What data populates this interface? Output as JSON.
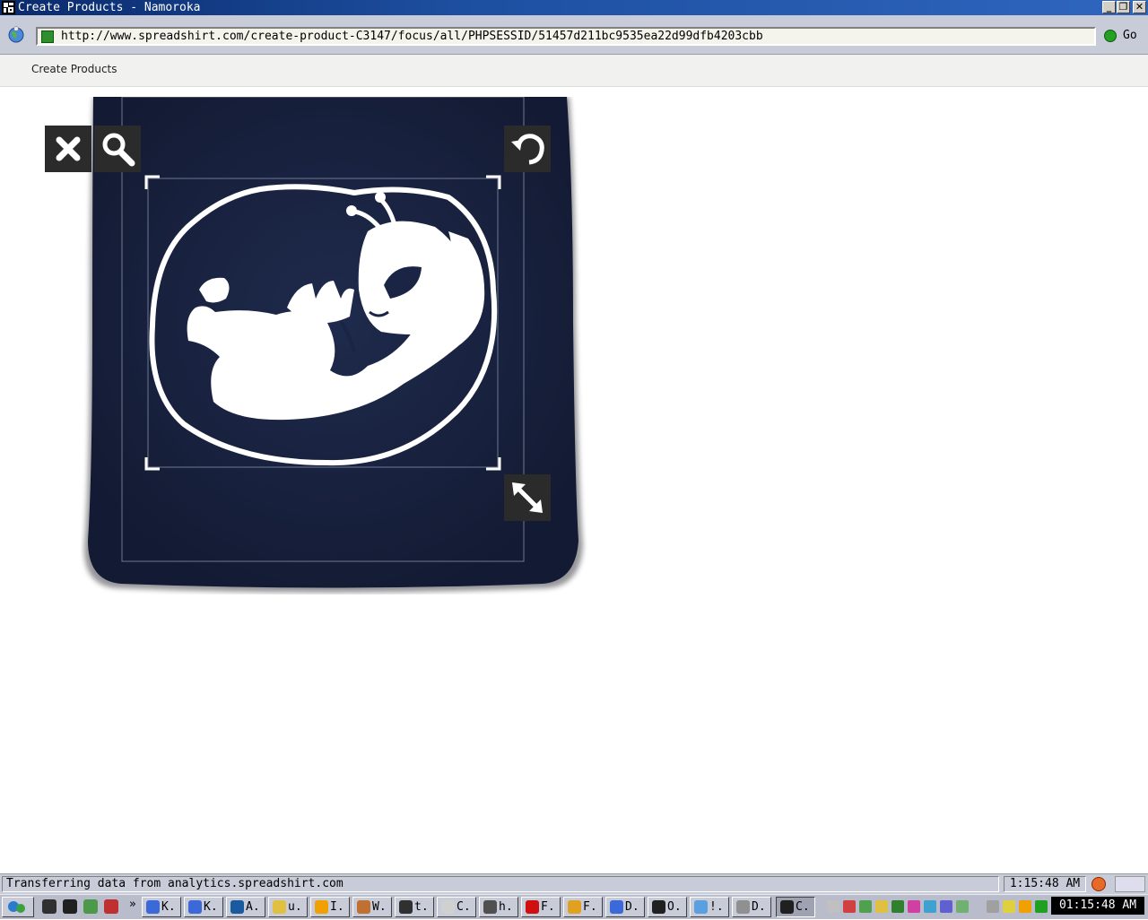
{
  "window": {
    "title": "Create Products - Namoroka",
    "buttons": {
      "minimize": "_",
      "maximize": "❐",
      "close": "✕"
    }
  },
  "navigation": {
    "url": "http://www.spreadshirt.com/create-product-C3147/focus/all/PHPSESSID/51457d211bc9535ea22d99dfb4203cbb",
    "go_label": "Go"
  },
  "page": {
    "tab_title": "Create Products"
  },
  "designer": {
    "tools": [
      {
        "name": "delete",
        "icon": "close-icon"
      },
      {
        "name": "zoom",
        "icon": "magnifier-icon"
      },
      {
        "name": "rotate",
        "icon": "rotate-icon"
      },
      {
        "name": "resize",
        "icon": "resize-arrows-icon"
      }
    ],
    "design": {
      "description_icon": "alien-fetus-graphic"
    },
    "colors": {
      "product": "#1a2444",
      "design": "#ffffff",
      "tool_bg": "#2b2b2b"
    }
  },
  "statusbar": {
    "text": "Transferring data from analytics.spreadshirt.com",
    "time": "1:15:48 AM"
  },
  "taskbar": {
    "chevron": "»",
    "tasks": [
      {
        "label": "K.",
        "color": "#3b6ad8"
      },
      {
        "label": "K.",
        "color": "#3b6ad8"
      },
      {
        "label": "A.",
        "color": "#1a5aa0"
      },
      {
        "label": "u.",
        "color": "#e0c040"
      },
      {
        "label": "I.",
        "color": "#f0a000"
      },
      {
        "label": "W.",
        "color": "#c07030"
      },
      {
        "label": "t.",
        "color": "#303030"
      },
      {
        "label": "C.",
        "color": "#d0d0d0"
      },
      {
        "label": "h.",
        "color": "#505050"
      },
      {
        "label": "F.",
        "color": "#d01010"
      },
      {
        "label": "F.",
        "color": "#e0a020"
      },
      {
        "label": "D.",
        "color": "#3b6ad8"
      },
      {
        "label": "O.",
        "color": "#202020"
      },
      {
        "label": "!.",
        "color": "#5aa0e0"
      },
      {
        "label": "D.",
        "color": "#909090"
      },
      {
        "label": "C.",
        "color": "#202020"
      }
    ],
    "clock": "01:15:48 AM"
  }
}
